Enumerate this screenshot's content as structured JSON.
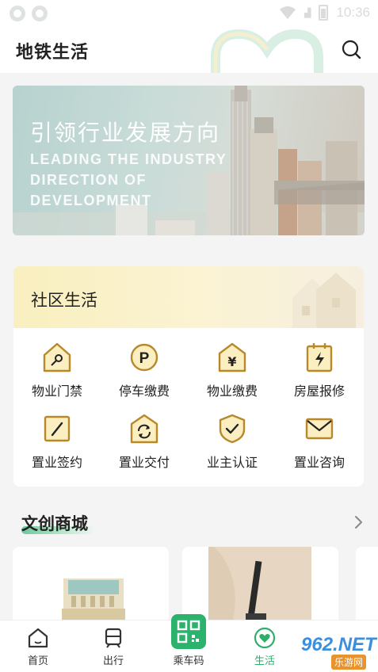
{
  "status_bar": {
    "time": "10:36"
  },
  "header": {
    "title": "地铁生活",
    "search_icon": "search-icon"
  },
  "banner": {
    "title": "引领行业发展方向",
    "subtitle": "LEADING THE INDUSTRY DIRECTION OF DEVELOPMENT"
  },
  "community": {
    "title": "社区生活",
    "services": [
      {
        "label": "物业门禁",
        "icon": "key-house-icon"
      },
      {
        "label": "停车缴费",
        "icon": "parking-icon"
      },
      {
        "label": "物业缴费",
        "icon": "yen-house-icon"
      },
      {
        "label": "房屋报修",
        "icon": "repair-calendar-icon"
      },
      {
        "label": "置业签约",
        "icon": "sign-pen-icon"
      },
      {
        "label": "置业交付",
        "icon": "delivery-refresh-icon"
      },
      {
        "label": "业主认证",
        "icon": "shield-check-icon"
      },
      {
        "label": "置业咨询",
        "icon": "mail-icon"
      }
    ]
  },
  "mall": {
    "title": "文创商城",
    "more_icon": "chevron-right-icon"
  },
  "bottom_nav": {
    "items": [
      {
        "label": "首页",
        "icon": "home-icon"
      },
      {
        "label": "出行",
        "icon": "train-icon"
      },
      {
        "label": "乘车码",
        "icon": "qr-code-icon"
      },
      {
        "label": "生活",
        "icon": "heart-icon"
      }
    ]
  },
  "watermark": {
    "text": "962.NET",
    "sub": "乐游网"
  },
  "colors": {
    "accent": "#2bb36d",
    "icon_gold": "#c79a2e",
    "icon_fill": "#fbeec0"
  }
}
